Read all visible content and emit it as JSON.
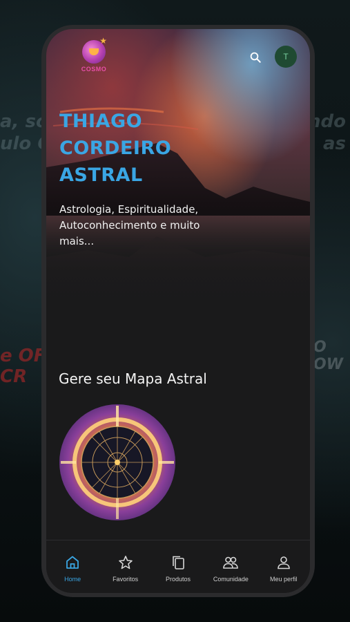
{
  "app": {
    "logo_text": "COSMO"
  },
  "header": {
    "avatar_initial": "T"
  },
  "hero": {
    "title": "THIAGO CORDEIRO ASTRAL",
    "subtitle": "Astrologia, Espiritualidade, Autoconhecimento e muito mais..."
  },
  "section": {
    "title": "Gere seu Mapa Astral"
  },
  "nav": {
    "items": [
      {
        "label": "Home",
        "icon": "home-icon",
        "active": true
      },
      {
        "label": "Favoritos",
        "icon": "star-icon",
        "active": false
      },
      {
        "label": "Produtos",
        "icon": "copy-icon",
        "active": false
      },
      {
        "label": "Comunidade",
        "icon": "users-icon",
        "active": false
      },
      {
        "label": "Meu perfil",
        "icon": "user-icon",
        "active": false
      }
    ]
  },
  "colors": {
    "accent": "#3aa6e4",
    "background": "#1a1a1b",
    "logo": "#e84fa8"
  }
}
